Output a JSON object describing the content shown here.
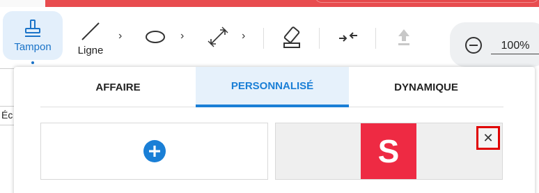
{
  "toolbar": {
    "tampon_label": "Tampon",
    "ligne_label": "Ligne",
    "chevron": "›",
    "zoom_value": "100%"
  },
  "tabs": [
    {
      "label": "AFFAIRE"
    },
    {
      "label": "PERSONNALISÉ",
      "active": true
    },
    {
      "label": "DYNAMIQUE"
    }
  ],
  "stamp": {
    "letter": "S",
    "close_glyph": "✕",
    "color": "#ee2a43"
  },
  "background": {
    "row_text": "Éc"
  },
  "colors": {
    "accent": "#1a7fd6",
    "brand_red": "#e84c4f",
    "close_highlight": "#e00000"
  }
}
